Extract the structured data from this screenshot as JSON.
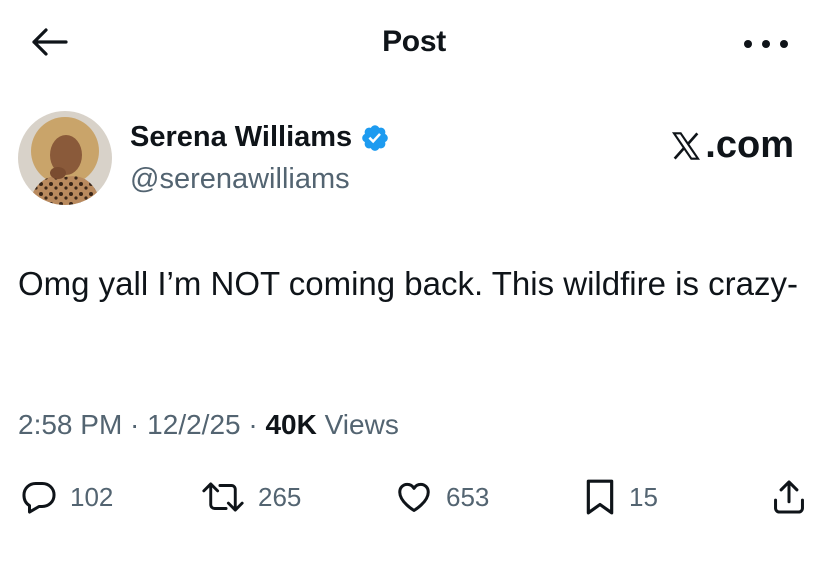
{
  "header": {
    "title": "Post",
    "back_icon": "arrow-left-icon",
    "more_icon": "more-horizontal-icon"
  },
  "author": {
    "name": "Serena Williams",
    "handle": "@serenawilliams",
    "verified": true,
    "verified_color": "#1d9bf0"
  },
  "brand": {
    "text": ".com",
    "logo": "x-logo"
  },
  "tweet": {
    "text": "Omg yall I’m NOT coming back. This wildfire is crazy-"
  },
  "meta": {
    "time": "2:58 PM",
    "sep1": " · ",
    "date": "12/2/25",
    "sep2": " · ",
    "views_count": "40K",
    "views_label": " Views"
  },
  "actions": {
    "replies": "102",
    "reposts": "265",
    "likes": "653",
    "bookmarks": "15"
  },
  "colors": {
    "text": "#0f1419",
    "secondary": "#536471",
    "accent": "#1d9bf0"
  }
}
